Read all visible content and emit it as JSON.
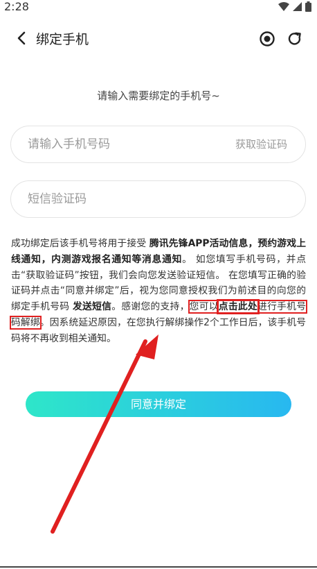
{
  "status_bar": {
    "time": "2:28"
  },
  "header": {
    "title": "绑定手机"
  },
  "prompt": "请输入需要绑定的手机号~",
  "phone_field": {
    "placeholder": "请输入手机号码",
    "get_code_label": "获取验证码"
  },
  "sms_field": {
    "placeholder": "短信验证码"
  },
  "notice": {
    "p1": "成功绑定后该手机号将用于接受 ",
    "bold1": "腾讯先锋APP活动信息，预约游戏上线通知，内测游戏报名通知等消息通知",
    "p2": "。 如您填写手机号码，并点击“获取验证码”按钮，我们会向您发送验证短信。 在您填写正确的验证码并点击“同意并绑定”后，视为您同意授权我们为前述目的向您的绑定手机号码 ",
    "bold2": "发送短信",
    "p3": "。感谢您的支持，",
    "boxed_pre": "您可以",
    "link": "点击此处",
    "boxed_post": "进行手机号码解绑",
    "p4": "。因系统延迟原因，在您执行解绑操作2个工作日后，该手机号码将不再收到相关通知。"
  },
  "agree_button": "同意并绑定",
  "colors": {
    "annotation_red": "#e02020",
    "button_start": "#2ee6c9",
    "button_end": "#28b8f0"
  }
}
